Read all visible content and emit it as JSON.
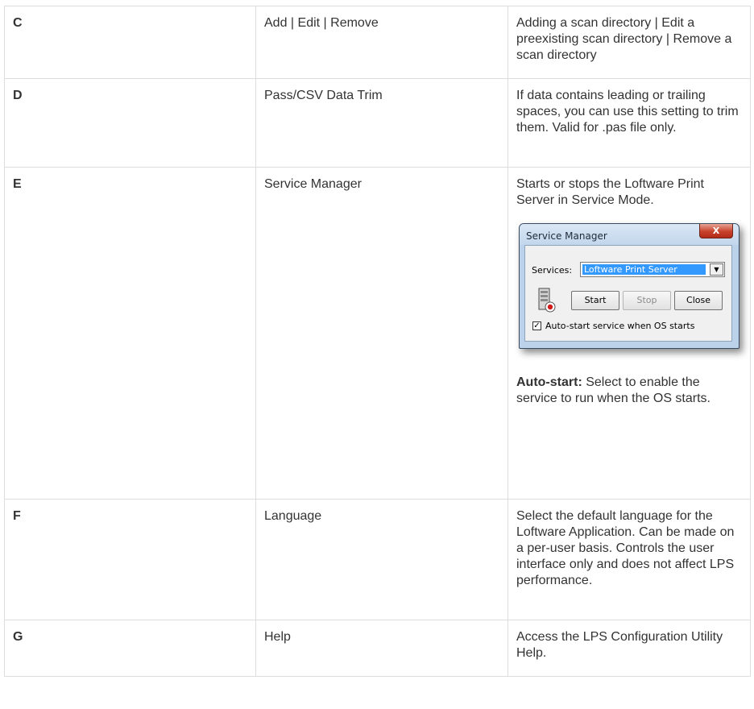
{
  "rows": [
    {
      "key": "C",
      "action": "Add | Edit | Remove",
      "description": "Adding a scan directory | Edit a preexisting scan directory | Remove a scan directory"
    },
    {
      "key": "D",
      "action": "Pass/CSV Data Trim",
      "description": "If data contains leading or trailing spaces, you can use this setting to trim them. Valid for .pas file only."
    },
    {
      "key": "E",
      "action": "Service Manager",
      "description": "Starts or stops the Loftware Print Server in Service Mode.",
      "dialog": {
        "title": "Service Manager",
        "close_glyph": "X",
        "services_label": "Services:",
        "services_value": "Loftware Print Server",
        "start_label": "Start",
        "stop_label": "Stop",
        "close_label": "Close",
        "autostart_checked": true,
        "autostart_label": "Auto-start service when OS starts"
      },
      "note_label": "Auto-start:",
      "note_text": " Select to enable the service to run when the OS starts."
    },
    {
      "key": "F",
      "action": "Language",
      "description": "Select the default language for the Loftware Application. Can be made on a per-user basis. Controls the user interface only and does not affect LPS performance."
    },
    {
      "key": "G",
      "action": "Help",
      "description": "Access the LPS Configuration Utility Help."
    }
  ],
  "colors": {
    "border": "#dddddd",
    "text": "#333333",
    "selection": "#3399ff",
    "close_button": "#c7412b"
  },
  "icons": {
    "dialog_close": "close-icon",
    "dropdown": "chevron-down-icon",
    "server": "server-stopped-icon",
    "checkbox": "checkbox-checked-icon"
  }
}
